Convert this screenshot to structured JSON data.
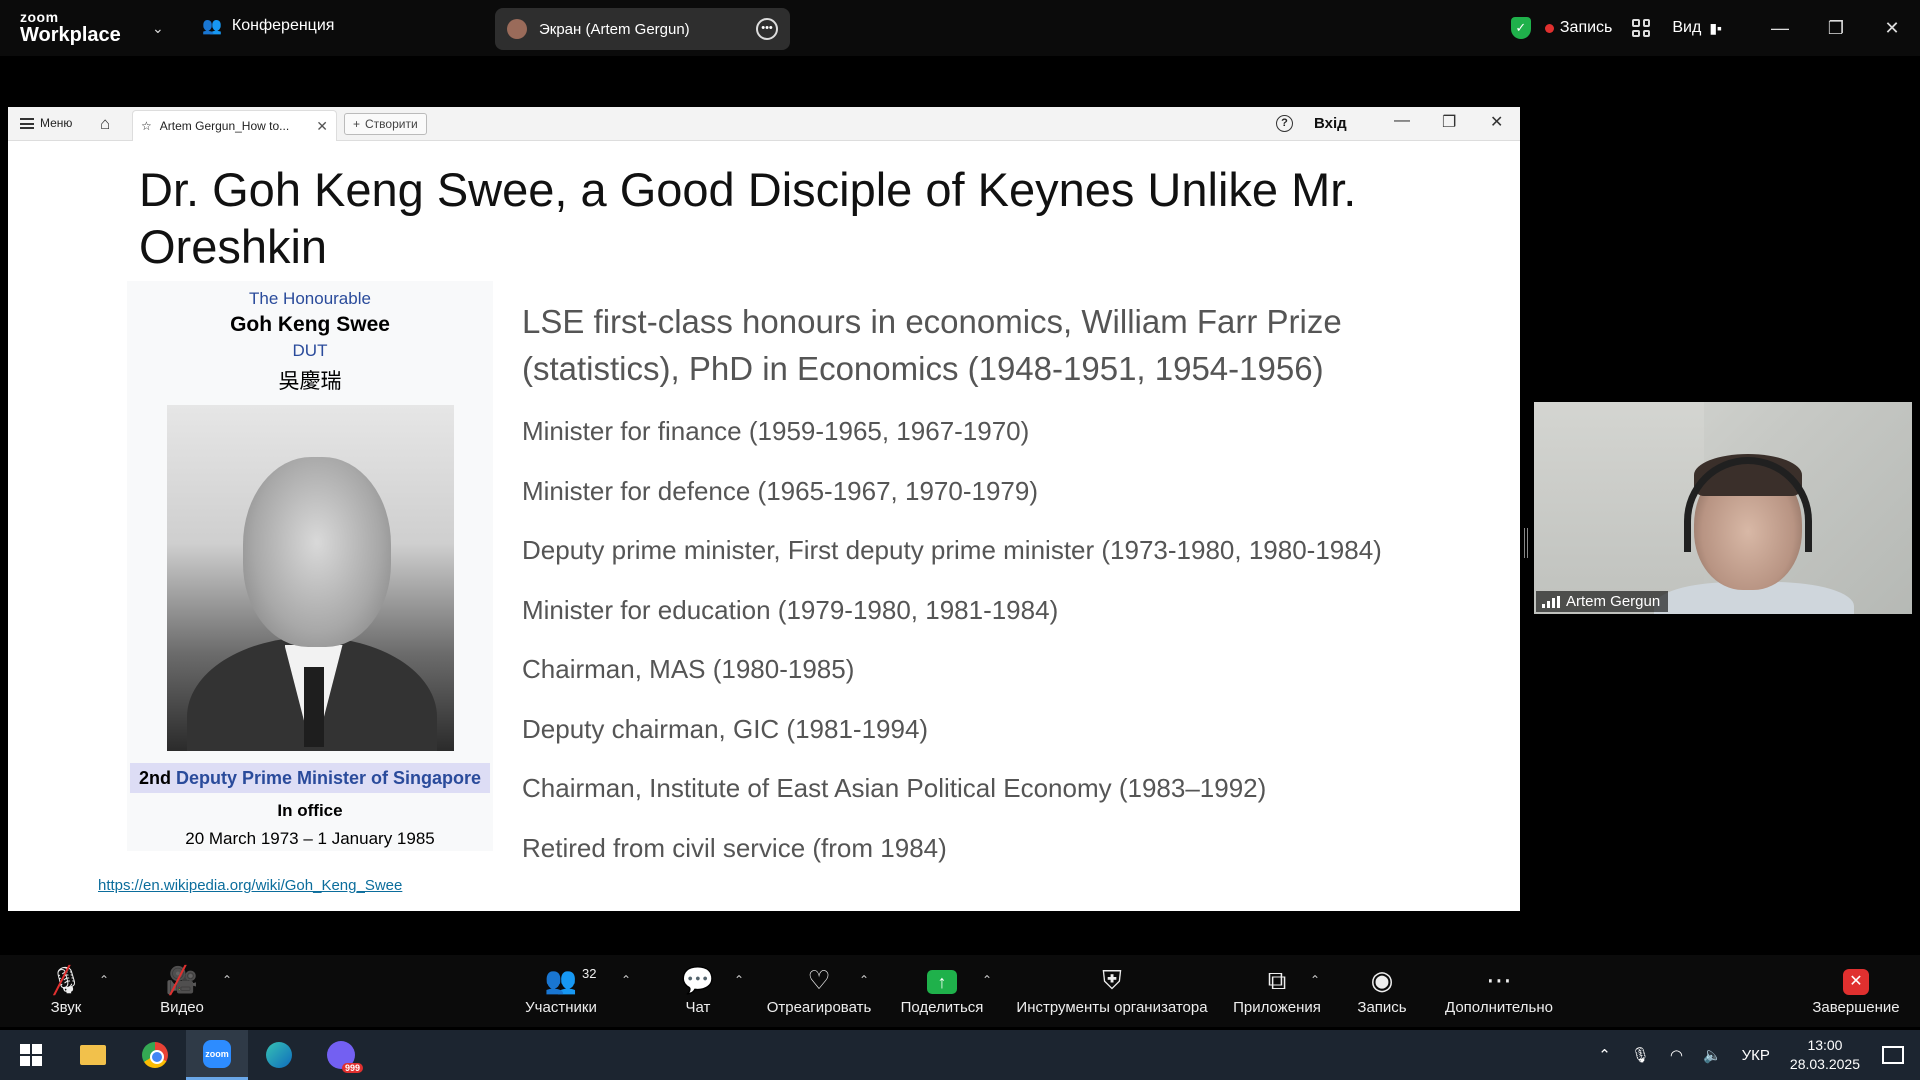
{
  "zoom": {
    "logo_line1": "zoom",
    "logo_line2": "Workplace",
    "meeting_label": "Конференция",
    "share_label": "Экран (Artem Gergun)",
    "record_label": "Запись",
    "view_label": "Вид",
    "security_color": "#1fb14b",
    "record_dot_color": "#e0302f"
  },
  "browser": {
    "menu_label": "Меню",
    "tab_title": "Artem Gergun_How to...",
    "new_label": "Створити",
    "login_label": "Вхід"
  },
  "slide": {
    "title": "Dr. Goh Keng Swee, a Good Disciple of Keynes Unlike Mr. Oreshkin",
    "infobox": {
      "honorific": "The Honourable",
      "name": "Goh Keng Swee",
      "postnominal": "DUT",
      "chinese_name": "吳慶瑞",
      "role_ordinal": "2nd",
      "role_link": "Deputy Prime Minister of Singapore",
      "office_label": "In office",
      "dates": "20 March 1973 – 1 January 1985"
    },
    "lead": "LSE first-class honours in economics, William Farr Prize (statistics), PhD in Economics (1948-1951, 1954-1956)",
    "bullets": [
      "Minister for finance (1959-1965, 1967-1970)",
      "Minister for defence (1965-1967, 1970-1979)",
      "Deputy prime minister, First deputy prime minister (1973-1980, 1980-1984)",
      "Minister for education (1979-1980, 1981-1984)",
      "Chairman, MAS (1980-1985)",
      "Deputy chairman, GIC (1981-1994)",
      "Chairman, Institute of East Asian Political Economy (1983–1992)",
      "Retired from civil service (from 1984)"
    ],
    "source_link": "https://en.wikipedia.org/wiki/Goh_Keng_Swee"
  },
  "participant": {
    "name": "Artem Gergun"
  },
  "toolbar": {
    "audio": "Звук",
    "video": "Видео",
    "participants": "Участники",
    "participants_count": "32",
    "chat": "Чат",
    "react": "Отреагировать",
    "share": "Поделиться",
    "host_tools": "Инструменты организатора",
    "apps": "Приложения",
    "record": "Запись",
    "more": "Дополнительно",
    "end": "Завершение"
  },
  "taskbar": {
    "viber_badge": "999",
    "zoom_icon_text": "zoom",
    "language": "УКР",
    "time": "13:00",
    "date": "28.03.2025"
  }
}
